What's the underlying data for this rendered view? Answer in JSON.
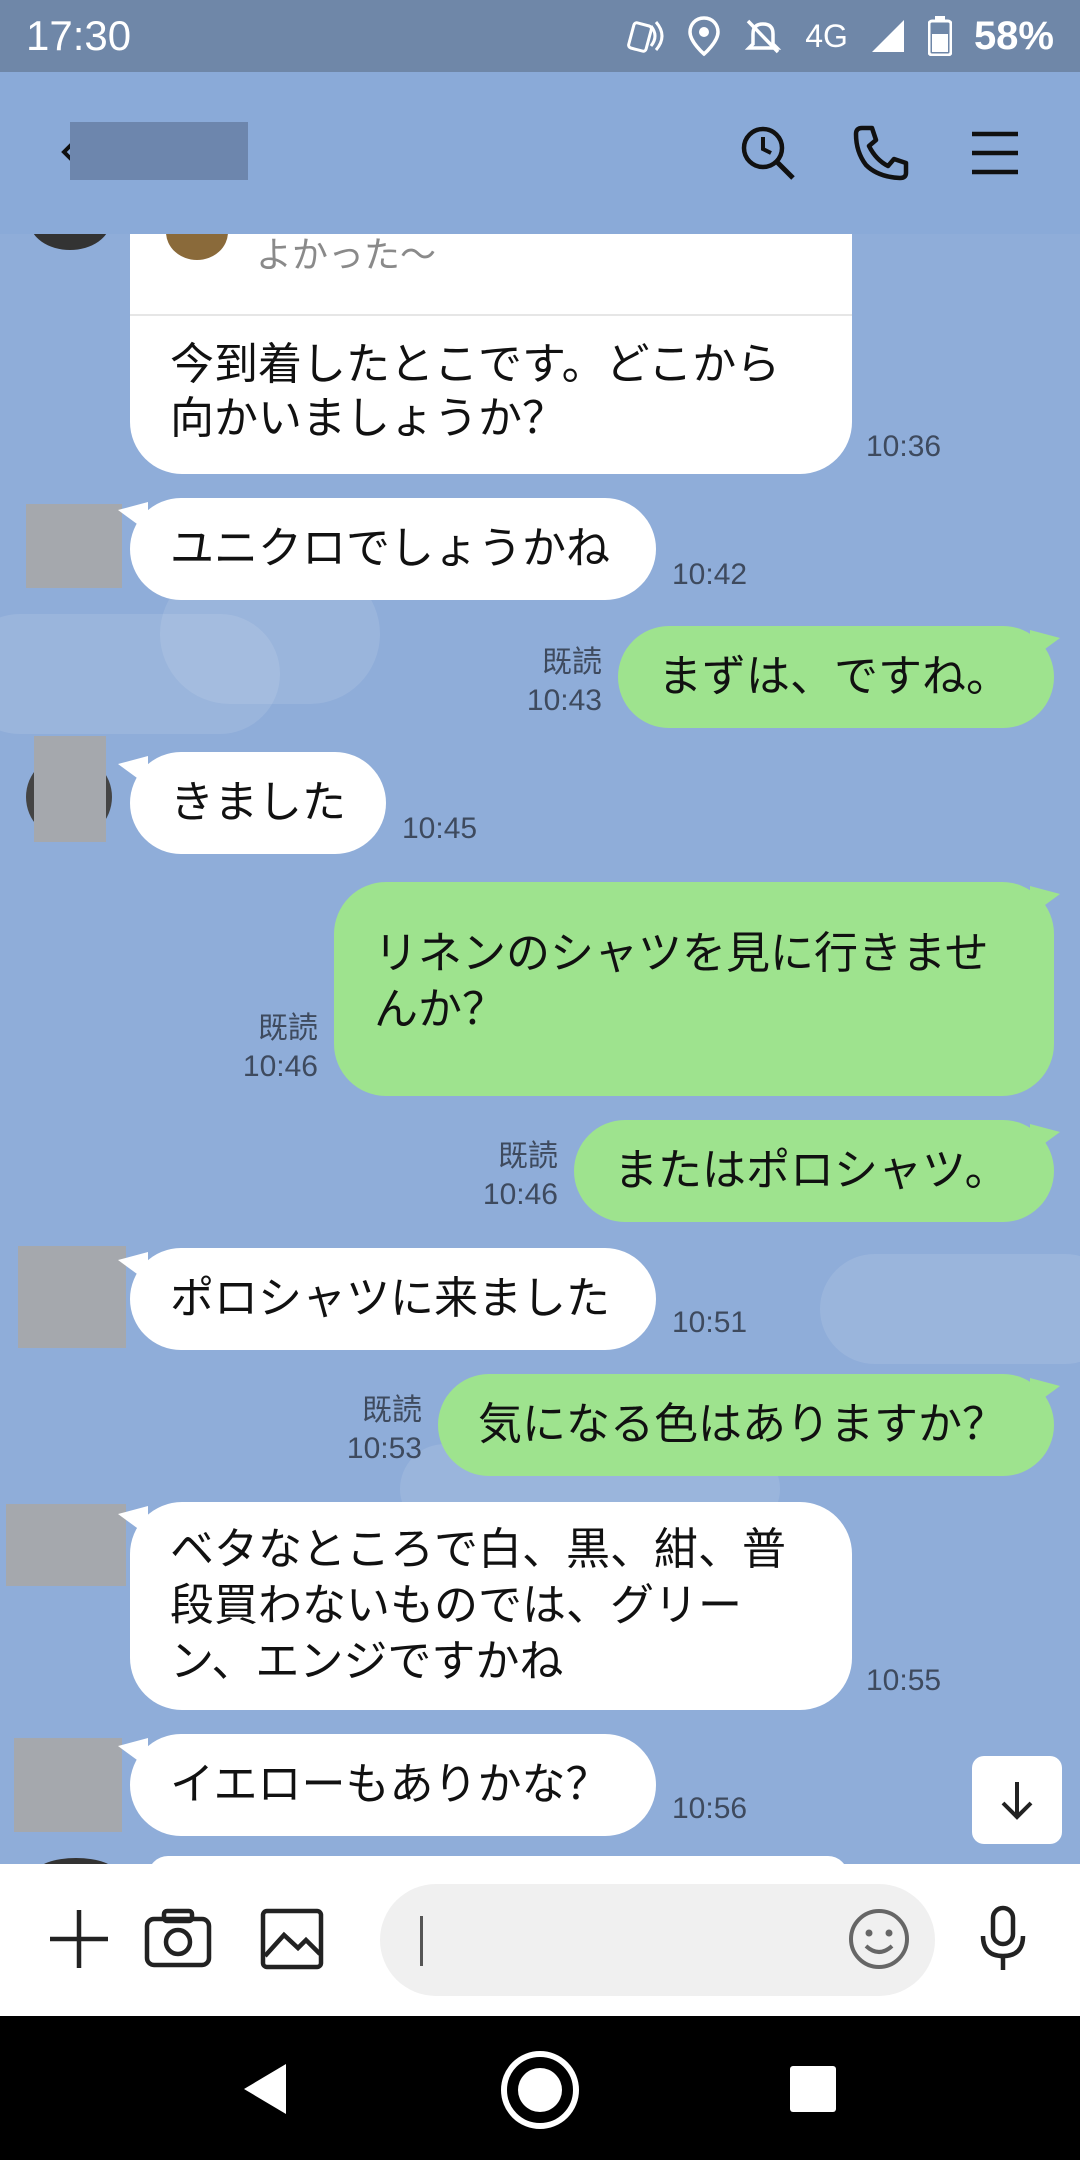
{
  "status_bar": {
    "time": "17:30",
    "network": "4G",
    "battery": "58%",
    "icons": [
      "nfc-icon",
      "location-icon",
      "bell-off-icon",
      "signal-icon",
      "battery-icon"
    ]
  },
  "header": {
    "back_icon": "chevron-left-icon",
    "actions": [
      "search-history-icon",
      "phone-icon",
      "menu-icon"
    ]
  },
  "reply_card": {
    "quote": "よかった〜",
    "text": "今到着したとこです。どこから\n向かいましょうか？",
    "time": "10:36"
  },
  "messages": [
    {
      "dir": "in",
      "text": "ユニクロでしょうかね",
      "time": "10:42"
    },
    {
      "dir": "out",
      "text": "まずは、ですね。",
      "read": "既読",
      "time": "10:43"
    },
    {
      "dir": "in",
      "text": "きました",
      "time": "10:45"
    },
    {
      "dir": "out",
      "text": "リネンのシャツを見に行きませ\nんか？",
      "read": "既読",
      "time": "10:46"
    },
    {
      "dir": "out",
      "text": "またはポロシャツ。",
      "read": "既読",
      "time": "10:46"
    },
    {
      "dir": "in",
      "text": "ポロシャツに来ました",
      "time": "10:51"
    },
    {
      "dir": "out",
      "text": "気になる色はありますか？",
      "read": "既読",
      "time": "10:53"
    },
    {
      "dir": "in",
      "text": "ベタなところで白、黒、紺、普\n段買わないものでは、グリー\nン、エンジですかね",
      "time": "10:55"
    },
    {
      "dir": "in",
      "text": "イエローもありかな？",
      "time": "10:56"
    }
  ],
  "input": {
    "placeholder": "",
    "left_icons": [
      "plus-icon",
      "camera-icon",
      "image-icon"
    ],
    "emoji_icon": "smile-icon",
    "mic_icon": "microphone-icon"
  },
  "nav": [
    "back-triangle-icon",
    "home-circle-icon",
    "recents-square-icon"
  ],
  "colors": {
    "background": "#8fadd9",
    "incoming_bubble": "#ffffff",
    "outgoing_bubble": "#9ee38e",
    "status_bar": "#6f87a8"
  }
}
